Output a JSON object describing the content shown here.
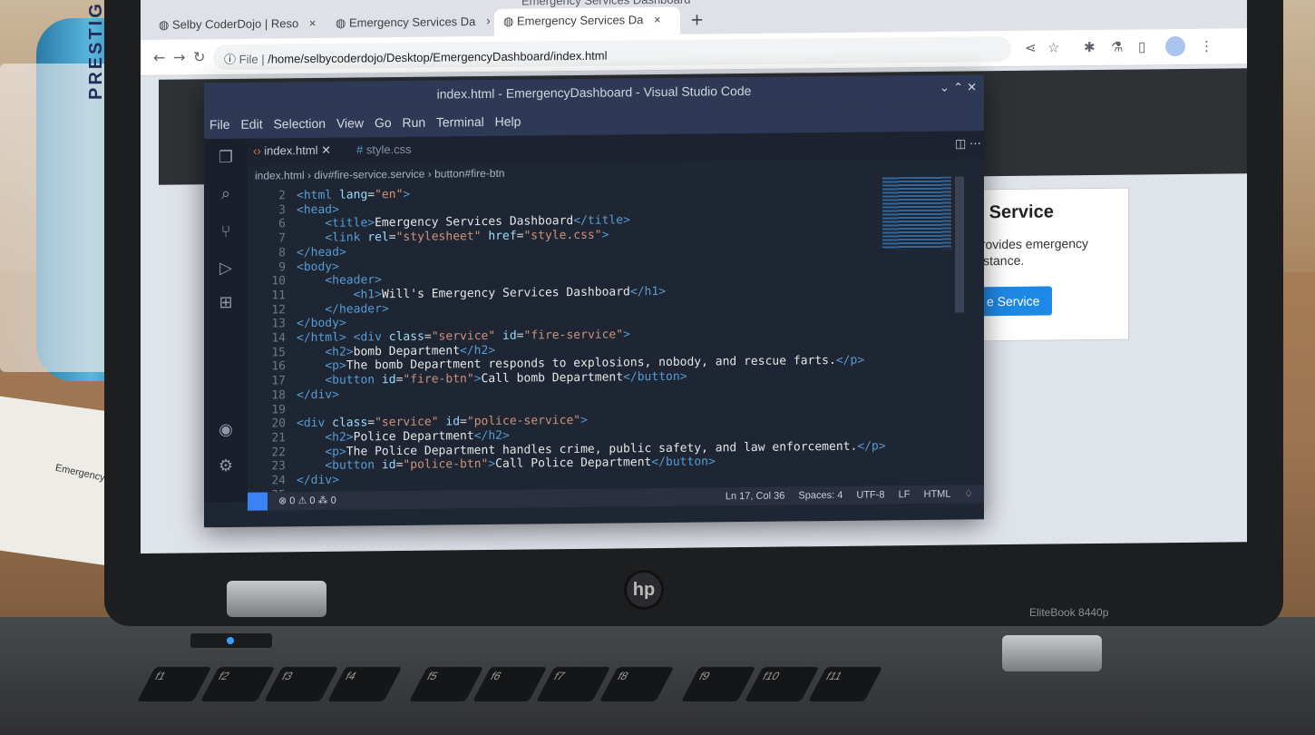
{
  "browser": {
    "window_title": "Emergency Services Dashboard",
    "tabs": [
      {
        "label": "Selby CoderDojo | Reso",
        "active": false
      },
      {
        "label": "Emergency Services Da",
        "active": false
      },
      {
        "label": "Emergency Services Da",
        "active": true
      }
    ],
    "tab_close": "×",
    "new_tab": "+",
    "address_scheme": "File",
    "address": "/home/selbycoderdojo/Desktop/EmergencyDashboard/index.html"
  },
  "page": {
    "card_title": "e Service",
    "card_text": "provides emergency sistance.",
    "card_button": "e Service"
  },
  "vscode": {
    "title": "index.html - EmergencyDashboard - Visual Studio Code",
    "menu": [
      "File",
      "Edit",
      "Selection",
      "View",
      "Go",
      "Run",
      "Terminal",
      "Help"
    ],
    "tabs": [
      {
        "label": "index.html",
        "active": true
      },
      {
        "label": "style.css",
        "active": false
      }
    ],
    "breadcrumb": [
      "index.html",
      "div#fire-service.service",
      "button#fire-btn"
    ],
    "code_lines": [
      {
        "n": "2",
        "t": "<html lang=\"en\">"
      },
      {
        "n": "3",
        "t": "<head>"
      },
      {
        "n": "6",
        "t": "    <title>Emergency Services Dashboard</title>"
      },
      {
        "n": "7",
        "t": "    <link rel=\"stylesheet\" href=\"style.css\">"
      },
      {
        "n": "8",
        "t": "</head>"
      },
      {
        "n": "9",
        "t": "<body>"
      },
      {
        "n": "10",
        "t": "    <header>"
      },
      {
        "n": "11",
        "t": "        <h1>Will's Emergency Services Dashboard</h1>"
      },
      {
        "n": "12",
        "t": "    </header>"
      },
      {
        "n": "13",
        "t": "</body>"
      },
      {
        "n": "14",
        "t": "</html> <div class=\"service\" id=\"fire-service\">"
      },
      {
        "n": "15",
        "t": "    <h2>bomb Department</h2>"
      },
      {
        "n": "16",
        "t": "    <p>The bomb Department responds to explosions, nobody, and rescue farts.</p>"
      },
      {
        "n": "17",
        "t": "    <button id=\"fire-btn\">Call bomb Department</button>"
      },
      {
        "n": "18",
        "t": "</div>"
      },
      {
        "n": "19",
        "t": ""
      },
      {
        "n": "20",
        "t": "<div class=\"service\" id=\"police-service\">"
      },
      {
        "n": "21",
        "t": "    <h2>Police Department</h2>"
      },
      {
        "n": "22",
        "t": "    <p>The Police Department handles crime, public safety, and law enforcement.</p>"
      },
      {
        "n": "23",
        "t": "    <button id=\"police-btn\">Call Police Department</button>"
      },
      {
        "n": "24",
        "t": "</div>"
      },
      {
        "n": "25",
        "t": ""
      }
    ],
    "status_left": "⊗ 0 ⚠ 0   ⁂ 0",
    "status_right": [
      "Ln 17, Col 36",
      "Spaces: 4",
      "UTF-8",
      "LF",
      "HTML"
    ]
  },
  "laptop": {
    "brand": "hp",
    "model": "EliteBook 8440p"
  },
  "desk": {
    "cup_text": "PRESTIGE LEISURE",
    "paper_text": "Emergency Services"
  }
}
